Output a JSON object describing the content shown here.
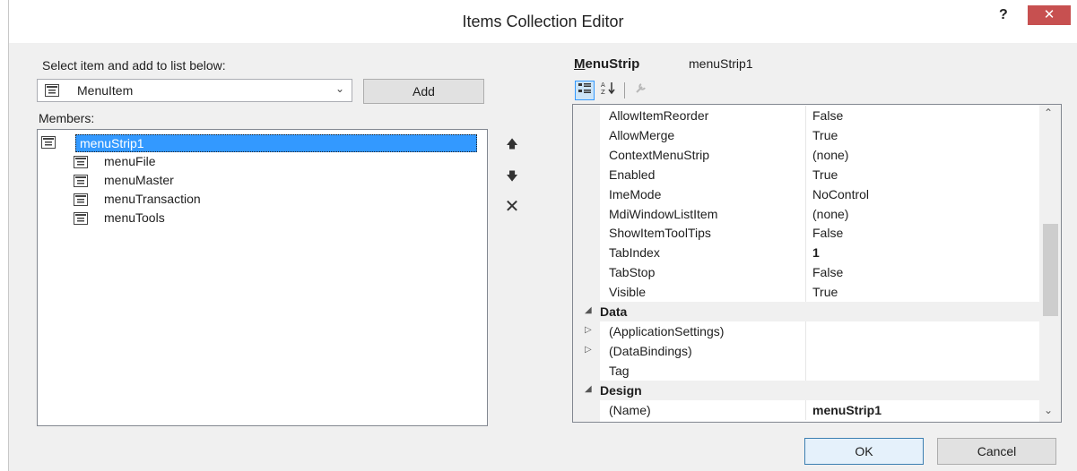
{
  "window": {
    "title": "Items Collection Editor",
    "help": "?",
    "close": "✕"
  },
  "left": {
    "select_label": "Select item and add to list below:",
    "combo_value": "MenuItem",
    "add_label": "Add",
    "members_label": "Members:",
    "members": [
      {
        "text": "menuStrip1",
        "selected": true,
        "indent": 0
      },
      {
        "text": "menuFile",
        "indent": 1
      },
      {
        "text": "menuMaster",
        "indent": 1
      },
      {
        "text": "menuTransaction",
        "indent": 1
      },
      {
        "text": "menuTools",
        "indent": 1
      }
    ],
    "side_buttons": {
      "up": "🡅",
      "down": "🡇",
      "remove": "✕"
    }
  },
  "properties": {
    "type": "MenuStrip",
    "type_underline": "M",
    "type_rest": "enuStrip",
    "object": "menuStrip1",
    "rows": [
      {
        "name": "AllowItemReorder",
        "value": "False"
      },
      {
        "name": "AllowMerge",
        "value": "True"
      },
      {
        "name": "ContextMenuStrip",
        "value": "(none)"
      },
      {
        "name": "Enabled",
        "value": "True"
      },
      {
        "name": "ImeMode",
        "value": "NoControl"
      },
      {
        "name": "MdiWindowListItem",
        "value": "(none)"
      },
      {
        "name": "ShowItemToolTips",
        "value": "False"
      },
      {
        "name": "TabIndex",
        "value": "1",
        "bold": true
      },
      {
        "name": "TabStop",
        "value": "False"
      },
      {
        "name": "Visible",
        "value": "True"
      },
      {
        "name": "Data",
        "category": true,
        "expander": "◢"
      },
      {
        "name": "(ApplicationSettings)",
        "value": "",
        "expander": "▷"
      },
      {
        "name": "(DataBindings)",
        "value": "",
        "expander": "▷"
      },
      {
        "name": "Tag",
        "value": ""
      },
      {
        "name": "Design",
        "category": true,
        "expander": "◢"
      },
      {
        "name": "(Name)",
        "value": "menuStrip1",
        "bold": true
      }
    ]
  },
  "buttons": {
    "ok": "OK",
    "cancel": "Cancel"
  },
  "colors": {
    "selection": "#3399ff",
    "close": "#c75050"
  }
}
